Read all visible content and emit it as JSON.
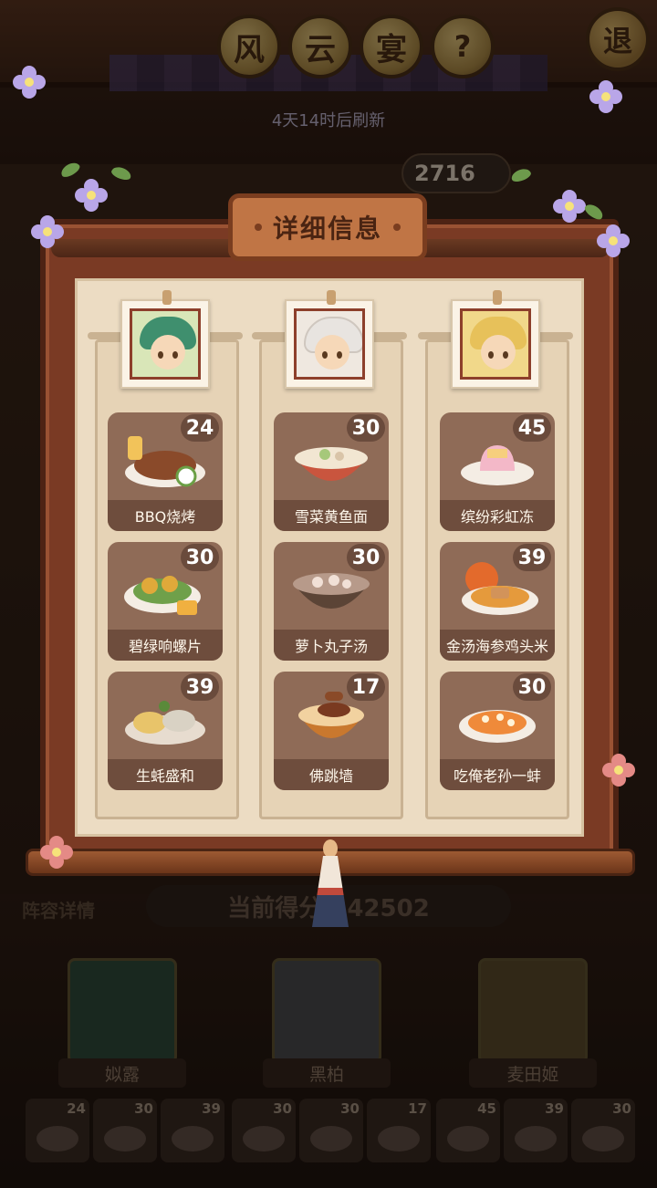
{
  "header": {
    "title_chars": [
      "风",
      "云",
      "宴"
    ],
    "help_label": "?",
    "exit_label": "退",
    "refresh_text": "4天14时后刷新",
    "score_badge": "2716"
  },
  "modal": {
    "title": "详细信息",
    "columns": [
      {
        "chef": "chef-1",
        "hair_color": "#3f8f6e",
        "dishes": [
          {
            "name": "BBQ烧烤",
            "count": "24",
            "color": "#8a4a2a"
          },
          {
            "name": "碧绿响螺片",
            "count": "30",
            "color": "#e0a93a"
          },
          {
            "name": "生蚝盛和",
            "count": "39",
            "color": "#e8c46a"
          }
        ]
      },
      {
        "chef": "chef-2",
        "hair_color": "#e8e4e0",
        "dishes": [
          {
            "name": "雪菜黄鱼面",
            "count": "30",
            "color": "#f2e6d2"
          },
          {
            "name": "萝卜丸子汤",
            "count": "30",
            "color": "#b79a8a"
          },
          {
            "name": "佛跳墙",
            "count": "17",
            "color": "#c9782e"
          }
        ]
      },
      {
        "chef": "chef-3",
        "hair_color": "#e7c15a",
        "dishes": [
          {
            "name": "缤纷彩虹冻",
            "count": "45",
            "color": "#f3b8c8"
          },
          {
            "name": "金汤海参鸡头米",
            "count": "39",
            "color": "#e59a3c"
          },
          {
            "name": "吃俺老孙一蚌",
            "count": "30",
            "color": "#ef8a3a"
          }
        ]
      }
    ]
  },
  "bottom": {
    "lineup_label": "阵容详情",
    "current_score": "当前得分 442502",
    "team": [
      {
        "name": "姒露"
      },
      {
        "name": "黑柏"
      },
      {
        "name": "麦田姬"
      }
    ],
    "slots": [
      "24",
      "30",
      "39",
      "30",
      "30",
      "17",
      "45",
      "39",
      "30"
    ]
  }
}
